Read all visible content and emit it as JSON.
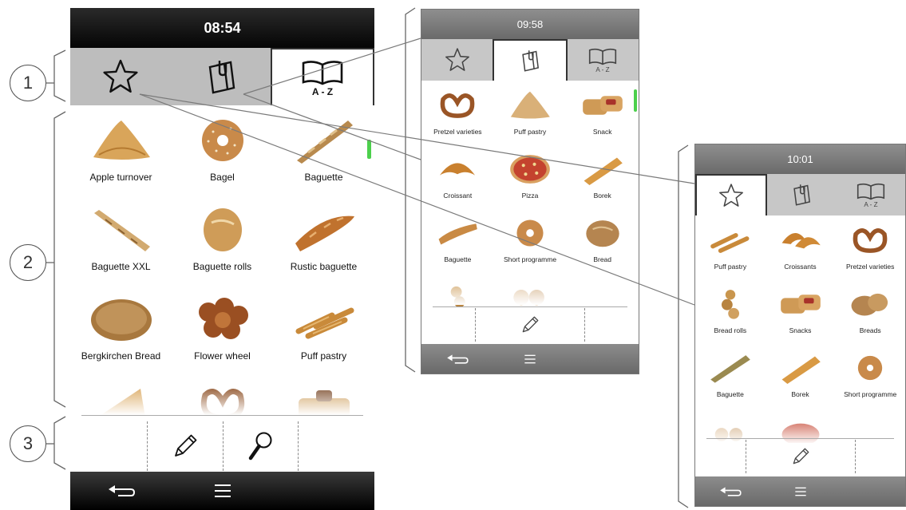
{
  "callouts": [
    "1",
    "2",
    "3"
  ],
  "device_left": {
    "time": "08:54",
    "tabs": [
      {
        "icon": "star-icon",
        "active": false
      },
      {
        "icon": "clipboard-icon",
        "active": false
      },
      {
        "icon": "book-az-icon",
        "active": true,
        "caption": "A - Z"
      }
    ],
    "items": [
      {
        "label": "Apple turnover",
        "icon": "apple-turnover-image"
      },
      {
        "label": "Bagel",
        "icon": "bagel-image"
      },
      {
        "label": "Baguette",
        "icon": "baguette-image"
      },
      {
        "label": "Baguette XXL",
        "icon": "baguette-xxl-image"
      },
      {
        "label": "Baguette rolls",
        "icon": "baguette-rolls-image"
      },
      {
        "label": "Rustic baguette",
        "icon": "rustic-baguette-image"
      },
      {
        "label": "Bergkirchen Bread",
        "icon": "bergkirchen-bread-image"
      },
      {
        "label": "Flower wheel",
        "icon": "flower-wheel-image"
      },
      {
        "label": "Puff pastry",
        "icon": "puff-pastry-image"
      }
    ],
    "tools": [
      "pencil-icon",
      "magnifier-icon"
    ],
    "nav": [
      "back-arrow-icon",
      "menu-icon"
    ]
  },
  "device_middle": {
    "time": "09:58",
    "tabs": [
      {
        "icon": "star-icon",
        "active": false
      },
      {
        "icon": "clipboard-icon",
        "active": true
      },
      {
        "icon": "book-az-icon",
        "active": false,
        "caption": "A - Z"
      }
    ],
    "items": [
      {
        "label": "Pretzel varieties",
        "icon": "pretzel-image"
      },
      {
        "label": "Puff pastry",
        "icon": "puff-pastry-image"
      },
      {
        "label": "Snack",
        "icon": "snack-image"
      },
      {
        "label": "Croissant",
        "icon": "croissant-image"
      },
      {
        "label": "Pizza",
        "icon": "pizza-image"
      },
      {
        "label": "Borek",
        "icon": "borek-image"
      },
      {
        "label": "Baguette",
        "icon": "baguette-image"
      },
      {
        "label": "Short programme",
        "icon": "bagel-image"
      },
      {
        "label": "Bread",
        "icon": "bread-image"
      }
    ],
    "tools": [
      "pencil-icon"
    ],
    "nav": [
      "back-arrow-icon",
      "menu-icon"
    ]
  },
  "device_right": {
    "time": "10:01",
    "tabs": [
      {
        "icon": "star-icon",
        "active": true
      },
      {
        "icon": "clipboard-icon",
        "active": false
      },
      {
        "icon": "book-az-icon",
        "active": false,
        "caption": "A - Z"
      }
    ],
    "items": [
      {
        "label": "Puff pastry",
        "icon": "puff-pastry-image"
      },
      {
        "label": "Croissants",
        "icon": "croissant-image"
      },
      {
        "label": "Pretzel varieties",
        "icon": "pretzel-image"
      },
      {
        "label": "Bread rolls",
        "icon": "bread-rolls-image"
      },
      {
        "label": "Snacks",
        "icon": "snack-image"
      },
      {
        "label": "Breads",
        "icon": "bread-image"
      },
      {
        "label": "Baguette",
        "icon": "baguette-image"
      },
      {
        "label": "Borek",
        "icon": "borek-image"
      },
      {
        "label": "Short programme",
        "icon": "bagel-image"
      }
    ],
    "tools": [
      "pencil-icon"
    ],
    "nav": [
      "back-arrow-icon",
      "menu-icon"
    ]
  },
  "colors": {
    "statusbar_dark": "#050505",
    "statusbar_grey": "#7a7a7a",
    "tab_inactive": "#bdbdbd",
    "scroll_indicator": "#4cd04c"
  }
}
